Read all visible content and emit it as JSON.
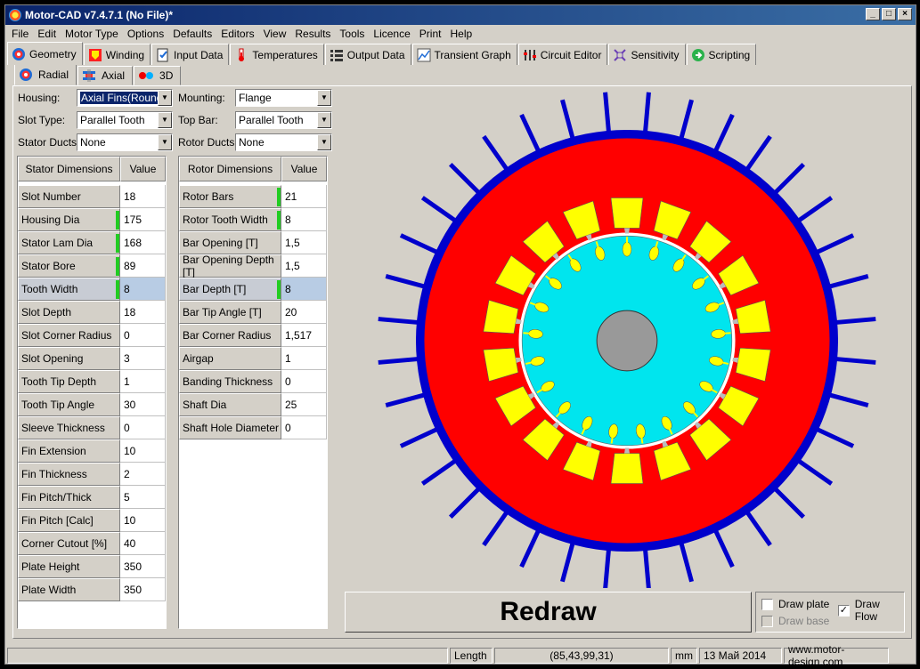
{
  "window": {
    "title": "Motor-CAD v7.4.7.1 (No File)*"
  },
  "menu": [
    "File",
    "Edit",
    "Motor Type",
    "Options",
    "Defaults",
    "Editors",
    "View",
    "Results",
    "Tools",
    "Licence",
    "Print",
    "Help"
  ],
  "tabs": [
    {
      "label": "Geometry",
      "icon": "geometry-icon"
    },
    {
      "label": "Winding",
      "icon": "winding-icon"
    },
    {
      "label": "Input Data",
      "icon": "input-data-icon"
    },
    {
      "label": "Temperatures",
      "icon": "thermometer-icon"
    },
    {
      "label": "Output Data",
      "icon": "output-data-icon"
    },
    {
      "label": "Transient Graph",
      "icon": "graph-icon"
    },
    {
      "label": "Circuit Editor",
      "icon": "circuit-icon"
    },
    {
      "label": "Sensitivity",
      "icon": "sensitivity-icon"
    },
    {
      "label": "Scripting",
      "icon": "scripting-icon"
    }
  ],
  "subtabs": [
    {
      "label": "Radial",
      "icon": "radial-icon"
    },
    {
      "label": "Axial",
      "icon": "axial-icon"
    },
    {
      "label": "3D",
      "icon": "3d-glasses-icon"
    }
  ],
  "settings": {
    "housing_label": "Housing:",
    "housing_value": "Axial Fins(Round)",
    "slot_type_label": "Slot Type:",
    "slot_type_value": "Parallel Tooth",
    "stator_ducts_label": "Stator Ducts:",
    "stator_ducts_value": "None",
    "mounting_label": "Mounting:",
    "mounting_value": "Flange",
    "top_bar_label": "Top Bar:",
    "top_bar_value": "Parallel Tooth",
    "rotor_ducts_label": "Rotor Ducts:",
    "rotor_ducts_value": "None"
  },
  "stator_table": {
    "headers": [
      "Stator Dimensions",
      "Value"
    ],
    "rows": [
      {
        "name": "Slot Number",
        "value": "18"
      },
      {
        "name": "Housing Dia",
        "value": "175"
      },
      {
        "name": "Stator Lam Dia",
        "value": "168"
      },
      {
        "name": "Stator Bore",
        "value": "89"
      },
      {
        "name": "Tooth Width",
        "value": "8"
      },
      {
        "name": "Slot Depth",
        "value": "18"
      },
      {
        "name": "Slot Corner Radius",
        "value": "0"
      },
      {
        "name": "Slot Opening",
        "value": "3"
      },
      {
        "name": "Tooth Tip Depth",
        "value": "1"
      },
      {
        "name": "Tooth Tip Angle",
        "value": "30"
      },
      {
        "name": "Sleeve Thickness",
        "value": "0"
      },
      {
        "name": "Fin Extension",
        "value": "10"
      },
      {
        "name": "Fin Thickness",
        "value": "2"
      },
      {
        "name": "Fin Pitch/Thick",
        "value": "5"
      },
      {
        "name": "Fin Pitch [Calc]",
        "value": "10"
      },
      {
        "name": "Corner Cutout [%]",
        "value": "40"
      },
      {
        "name": "Plate Height",
        "value": "350"
      },
      {
        "name": "Plate Width",
        "value": "350"
      }
    ]
  },
  "rotor_table": {
    "headers": [
      "Rotor Dimensions",
      "Value"
    ],
    "rows": [
      {
        "name": "Rotor Bars",
        "value": "21"
      },
      {
        "name": "Rotor Tooth Width",
        "value": "8"
      },
      {
        "name": "Bar Opening [T]",
        "value": "1,5"
      },
      {
        "name": "Bar Opening Depth [T]",
        "value": "1,5"
      },
      {
        "name": "Bar Depth [T]",
        "value": "8"
      },
      {
        "name": "Bar Tip Angle [T]",
        "value": "20"
      },
      {
        "name": "Bar Corner Radius",
        "value": "1,517"
      },
      {
        "name": "Airgap",
        "value": "1"
      },
      {
        "name": "Banding Thickness",
        "value": "0"
      },
      {
        "name": "Shaft Dia",
        "value": "25"
      },
      {
        "name": "Shaft Hole Diameter",
        "value": "0"
      }
    ]
  },
  "colors": {
    "housing": "#0000cc",
    "stator": "#ff0000",
    "slot": "#ffff00",
    "rotor": "#00e5ee",
    "shaft": "#999999",
    "airgap": "#ffffff"
  },
  "redraw_label": "Redraw",
  "options": {
    "draw_plate": {
      "label": "Draw plate",
      "checked": false
    },
    "draw_flow": {
      "label": "Draw Flow",
      "checked": true
    },
    "draw_base": {
      "label": "Draw base",
      "checked": false,
      "disabled": true
    }
  },
  "status": {
    "field1": "",
    "length_label": "Length",
    "coords": "(85,43,99,31)",
    "unit": "mm",
    "date": "13 Май 2014",
    "website": "www.motor-design.com"
  }
}
